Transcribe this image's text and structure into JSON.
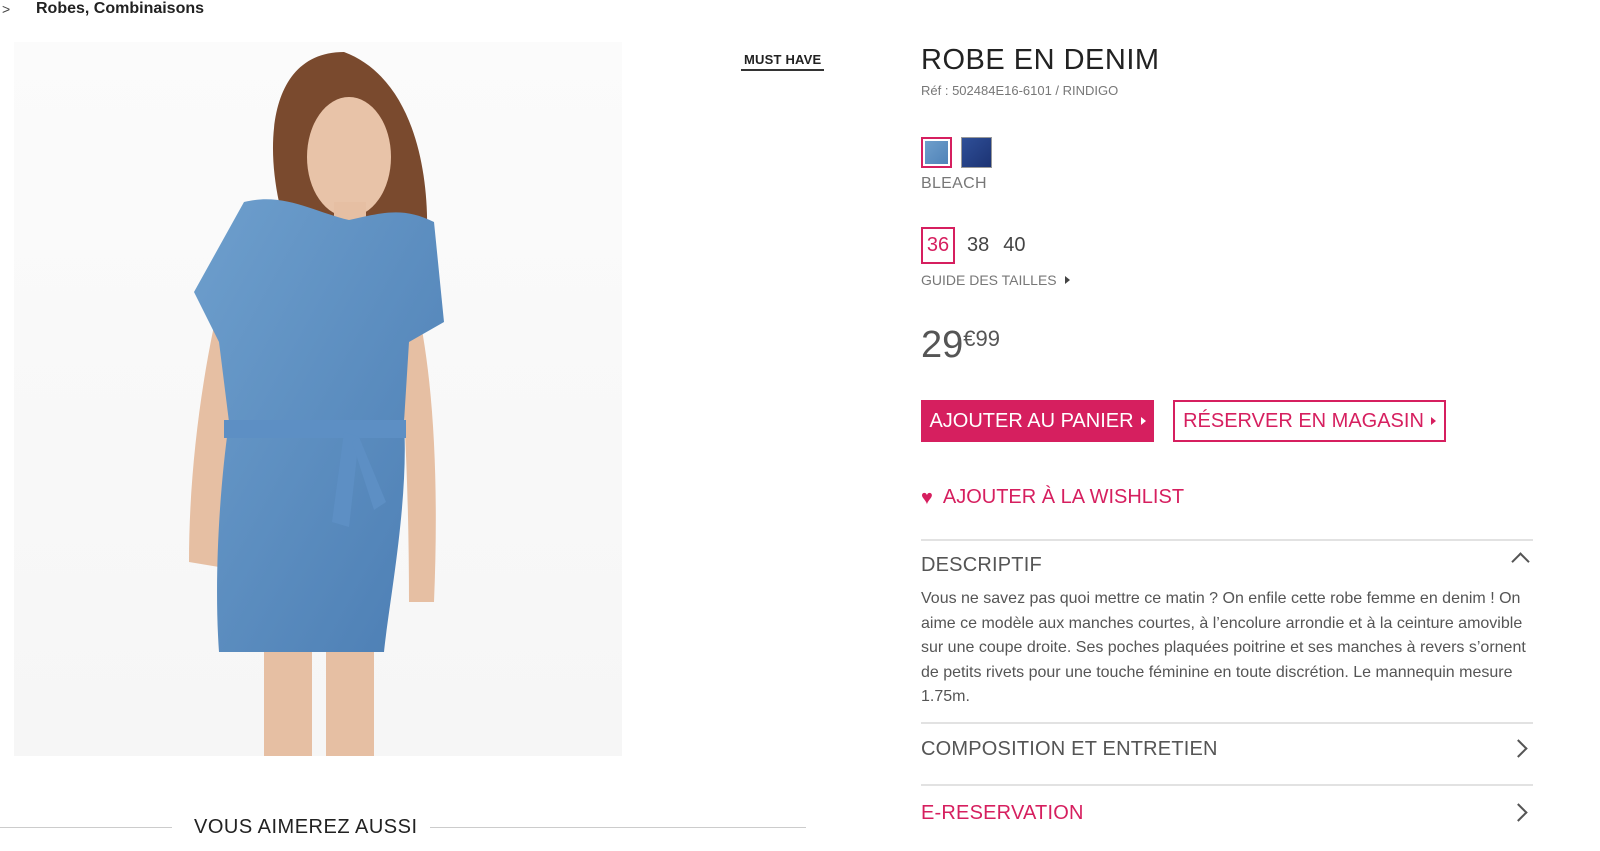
{
  "breadcrumb": {
    "separator": ">",
    "current": "Robes, Combinaisons"
  },
  "product": {
    "badge": "MUST HAVE",
    "title": "ROBE EN DENIM",
    "reference": "Réf : 502484E16-6101 / RINDIGO",
    "image_icon": "denim-dress-photo",
    "colors": [
      {
        "name": "BLEACH",
        "hex": "#5b8fc2",
        "selected": true
      },
      {
        "name": "",
        "hex": "#273f86",
        "selected": false
      }
    ],
    "selected_color_label": "BLEACH",
    "sizes": [
      "36",
      "38",
      "40"
    ],
    "selected_size": "36",
    "size_guide": "GUIDE DES TAILLES",
    "price_int": "29",
    "price_dec": "€99"
  },
  "actions": {
    "add_to_cart": "AJOUTER AU PANIER",
    "reserve_in_store": "RÉSERVER EN MAGASIN",
    "wishlist": "AJOUTER À LA WISHLIST",
    "accent_color": "#d61f5f"
  },
  "sections": {
    "descriptif": {
      "title": "DESCRIPTIF",
      "text": "Vous ne savez pas quoi mettre ce matin ? On enfile cette robe femme en denim ! On aime ce modèle aux manches courtes, à l’encolure arrondie et à la ceinture amovible sur une coupe droite. Ses poches plaquées poitrine et ses manches à revers s’ornent de petits rivets pour une touche féminine en toute discrétion. Le mannequin mesure 1.75m."
    },
    "composition": {
      "title": "COMPOSITION ET ENTRETIEN"
    },
    "ereservation": {
      "title": "E-RESERVATION"
    }
  },
  "recommendations": {
    "title": "VOUS AIMEREZ AUSSI"
  }
}
